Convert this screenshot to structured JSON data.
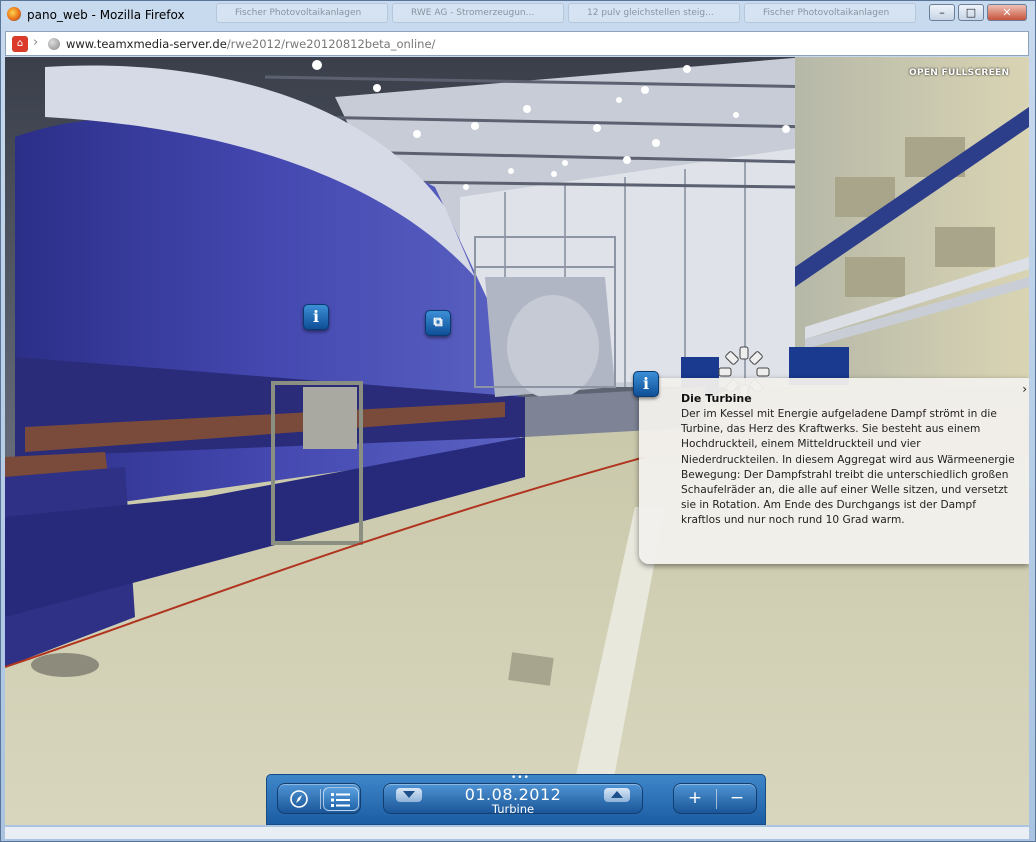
{
  "window": {
    "title": "pano_web - Mozilla Firefox",
    "background_tabs": [
      "Fischer Photovoltaikanlagen",
      "RWE AG - Stromerzeugun...",
      "12 pulv gleichstellen steig...",
      "Fischer Photovoltaikanlagen"
    ],
    "minimize_label": "–",
    "maximize_label": "□",
    "close_label": "✕"
  },
  "address_bar": {
    "url_domain": "www.teamxmedia-server.de",
    "url_path": "/rwe2012/rwe20120812beta_online/"
  },
  "viewer": {
    "fullscreen_label": "OPEN FULLSCREEN",
    "hotspots": [
      {
        "kind": "info",
        "glyph": "i"
      },
      {
        "kind": "gallery",
        "glyph": "⧉"
      },
      {
        "kind": "info",
        "glyph": "i"
      }
    ]
  },
  "info_panel": {
    "title": "Die Turbine",
    "text": "Der im Kessel mit Energie aufgeladene Dampf strömt in die Turbine, das Herz des Kraftwerks. Sie besteht aus einem Hochdruckteil, einem Mitteldruckteil und vier Niederdruckteilen. In diesem Aggregat wird aus Wärmeenergie Bewegung: Der Dampfstrahl treibt die unterschiedlich großen Schaufelräder an, die alle auf einer Welle sitzen, und versetzt sie in Rotation. Am Ende des Durchgangs ist der Dampf kraftlos und nur noch rund 10 Grad warm.",
    "close_glyph": "›",
    "icon_glyph": "i"
  },
  "controls": {
    "grip": "•••",
    "compass_glyph": "⦶",
    "list_glyph": "☰",
    "date": "01.08.2012",
    "scene": "Turbine",
    "zoom_in": "+",
    "zoom_out": "−"
  },
  "colors": {
    "panel_accent": "#1f63aa",
    "hotspot_blue": "#0e4f97",
    "turbine_blue": "#3b3fa0"
  }
}
